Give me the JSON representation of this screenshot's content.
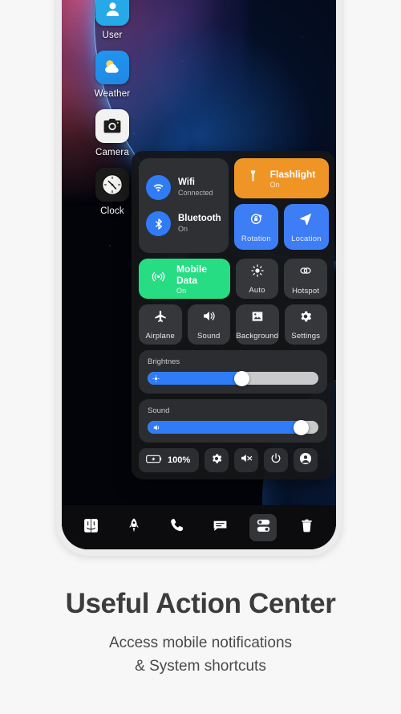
{
  "wallpaper": {
    "name": "space-planet-nebula"
  },
  "home_apps": [
    {
      "label": "User",
      "icon": "user-icon"
    },
    {
      "label": "Weather",
      "icon": "weather-icon"
    },
    {
      "label": "Camera",
      "icon": "camera-icon"
    },
    {
      "label": "Clock",
      "icon": "clock-icon"
    }
  ],
  "control_center": {
    "connectivity": [
      {
        "title": "Wifi",
        "status": "Connected",
        "icon": "wifi-icon",
        "color": "#2f7cf6"
      },
      {
        "title": "Bluetooth",
        "status": "On",
        "icon": "bluetooth-icon",
        "color": "#2f7cf6"
      }
    ],
    "flashlight": {
      "title": "Flashlight",
      "status": "On",
      "icon": "flashlight-icon",
      "color": "#ef9526"
    },
    "mobile_data": {
      "title": "Mobile Data",
      "status": "On",
      "icon": "signal-icon",
      "color": "#27dd84"
    },
    "tiles": [
      {
        "label": "Rotation",
        "icon": "rotation-lock-icon",
        "active": true
      },
      {
        "label": "Location",
        "icon": "location-arrow-icon",
        "active": true
      },
      {
        "label": "Auto",
        "icon": "brightness-auto-icon",
        "active": false
      },
      {
        "label": "Hotspot",
        "icon": "hotspot-icon",
        "active": false
      },
      {
        "label": "Airplane",
        "icon": "airplane-icon",
        "active": false
      },
      {
        "label": "Sound",
        "icon": "speaker-icon",
        "active": false
      },
      {
        "label": "Background",
        "icon": "wallpaper-icon",
        "active": false
      },
      {
        "label": "Settings",
        "icon": "gear-icon",
        "active": false
      }
    ],
    "sliders": [
      {
        "label": "Brightnes",
        "value": 55,
        "icon": "brightness-icon"
      },
      {
        "label": "Sound",
        "value": 90,
        "icon": "volume-icon"
      }
    ],
    "actions": {
      "battery": {
        "label": "100%",
        "icon": "battery-charging-icon"
      },
      "buttons": [
        {
          "icon": "gear-icon",
          "name": "settings-action"
        },
        {
          "icon": "do-not-disturb-icon",
          "name": "mute-action"
        },
        {
          "icon": "power-icon",
          "name": "power-action"
        },
        {
          "icon": "account-icon",
          "name": "account-action"
        }
      ]
    }
  },
  "dock": [
    {
      "icon": "finder-icon",
      "active": false
    },
    {
      "icon": "rocket-icon",
      "active": false
    },
    {
      "icon": "phone-icon",
      "active": false
    },
    {
      "icon": "message-icon",
      "active": false
    },
    {
      "icon": "toggles-icon",
      "active": true
    },
    {
      "icon": "trash-icon",
      "active": false
    }
  ],
  "caption": {
    "headline": "Useful Action Center",
    "subline_1": "Access mobile notifications",
    "subline_2": "& System shortcuts"
  }
}
